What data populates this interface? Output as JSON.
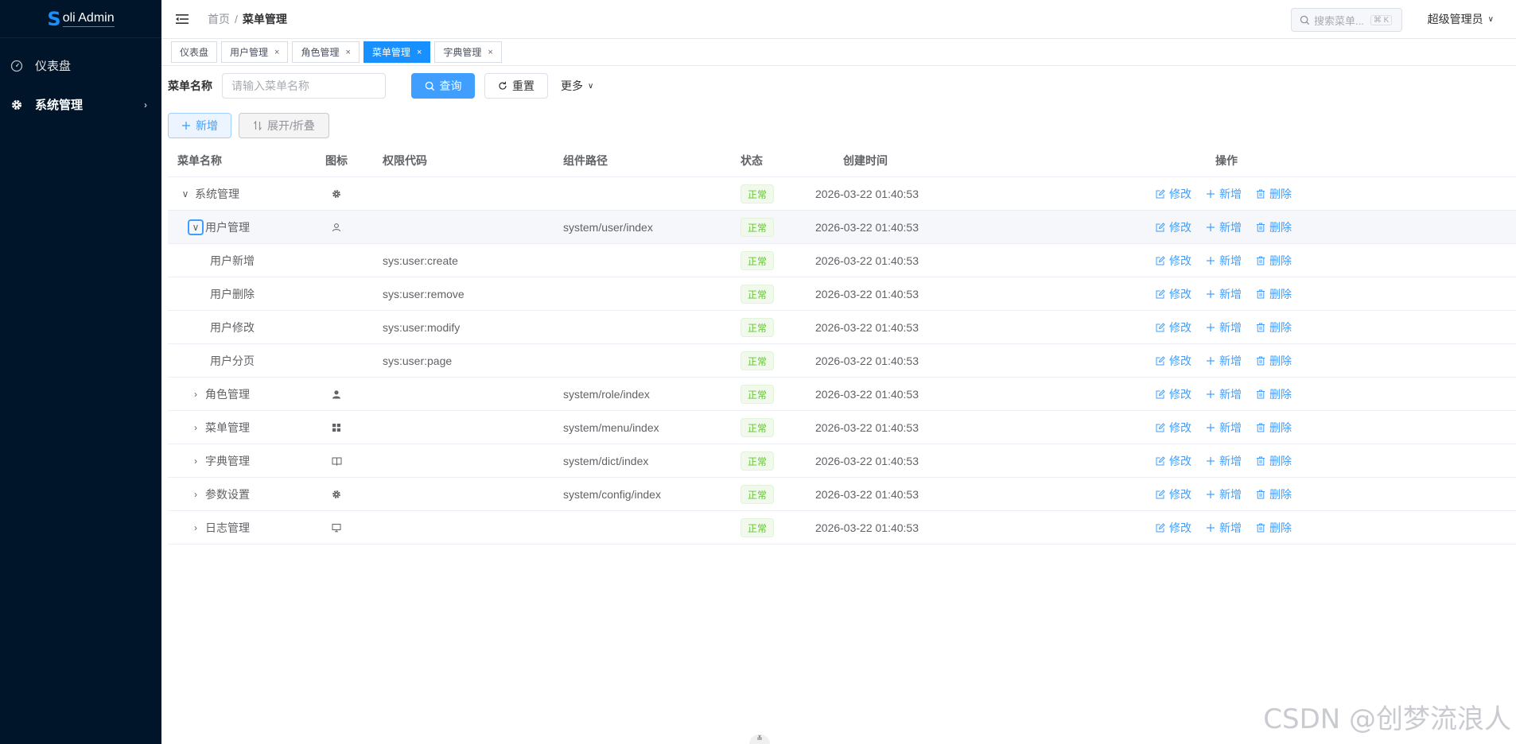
{
  "app": {
    "logo_mark": "S",
    "logo_text": "oli Admin"
  },
  "sidebar": {
    "items": [
      {
        "label": "仪表盘",
        "icon": "dashboard-icon"
      },
      {
        "label": "系统管理",
        "icon": "gear-icon",
        "active": true
      }
    ]
  },
  "header": {
    "breadcrumb_home": "首页",
    "breadcrumb_sep": "/",
    "breadcrumb_current": "菜单管理",
    "search_placeholder": "搜索菜单...",
    "search_shortcut": "⌘ K",
    "user_name": "超级管理员"
  },
  "tabs": [
    {
      "label": "仪表盘",
      "closable": false,
      "active": false
    },
    {
      "label": "用户管理",
      "closable": true,
      "active": false
    },
    {
      "label": "角色管理",
      "closable": true,
      "active": false
    },
    {
      "label": "菜单管理",
      "closable": true,
      "active": true
    },
    {
      "label": "字典管理",
      "closable": true,
      "active": false
    }
  ],
  "search_form": {
    "label": "菜单名称",
    "placeholder": "请输入菜单名称",
    "query_button": "查询",
    "reset_button": "重置",
    "more": "更多"
  },
  "toolbar": {
    "add_button": "新增",
    "expand_button": "展开/折叠"
  },
  "table": {
    "columns": {
      "name": "菜单名称",
      "icon": "图标",
      "perm": "权限代码",
      "path": "组件路径",
      "status": "状态",
      "time": "创建时间",
      "ops": "操作"
    },
    "ops": {
      "edit": "修改",
      "add": "新增",
      "delete": "删除"
    },
    "rows": [
      {
        "name": "系统管理",
        "level": 0,
        "expander": "expanded",
        "icon": "gear-icon",
        "perm": "",
        "path": "",
        "status": "正常",
        "time": "2026-03-22 01:40:53"
      },
      {
        "name": "用户管理",
        "level": 1,
        "expander": "expanded-focused",
        "icon": "user-icon",
        "perm": "",
        "path": "system/user/index",
        "status": "正常",
        "time": "2026-03-22 01:40:53"
      },
      {
        "name": "用户新增",
        "level": 2,
        "expander": "none",
        "icon": "",
        "perm": "sys:user:create",
        "path": "",
        "status": "正常",
        "time": "2026-03-22 01:40:53"
      },
      {
        "name": "用户删除",
        "level": 2,
        "expander": "none",
        "icon": "",
        "perm": "sys:user:remove",
        "path": "",
        "status": "正常",
        "time": "2026-03-22 01:40:53"
      },
      {
        "name": "用户修改",
        "level": 2,
        "expander": "none",
        "icon": "",
        "perm": "sys:user:modify",
        "path": "",
        "status": "正常",
        "time": "2026-03-22 01:40:53"
      },
      {
        "name": "用户分页",
        "level": 2,
        "expander": "none",
        "icon": "",
        "perm": "sys:user:page",
        "path": "",
        "status": "正常",
        "time": "2026-03-22 01:40:53"
      },
      {
        "name": "角色管理",
        "level": 1,
        "expander": "collapsed",
        "icon": "user-filled-icon",
        "perm": "",
        "path": "system/role/index",
        "status": "正常",
        "time": "2026-03-22 01:40:53"
      },
      {
        "name": "菜单管理",
        "level": 1,
        "expander": "collapsed",
        "icon": "grid-icon",
        "perm": "",
        "path": "system/menu/index",
        "status": "正常",
        "time": "2026-03-22 01:40:53"
      },
      {
        "name": "字典管理",
        "level": 1,
        "expander": "collapsed",
        "icon": "book-icon",
        "perm": "",
        "path": "system/dict/index",
        "status": "正常",
        "time": "2026-03-22 01:40:53"
      },
      {
        "name": "参数设置",
        "level": 1,
        "expander": "collapsed",
        "icon": "gear-icon",
        "perm": "",
        "path": "system/config/index",
        "status": "正常",
        "time": "2026-03-22 01:40:53"
      },
      {
        "name": "日志管理",
        "level": 1,
        "expander": "collapsed",
        "icon": "monitor-icon",
        "perm": "",
        "path": "",
        "status": "正常",
        "time": "2026-03-22 01:40:53"
      }
    ]
  },
  "watermark": "CSDN @创梦流浪人",
  "colors": {
    "sidebar_bg": "#001529",
    "primary": "#409eff",
    "success": "#67c23a"
  }
}
